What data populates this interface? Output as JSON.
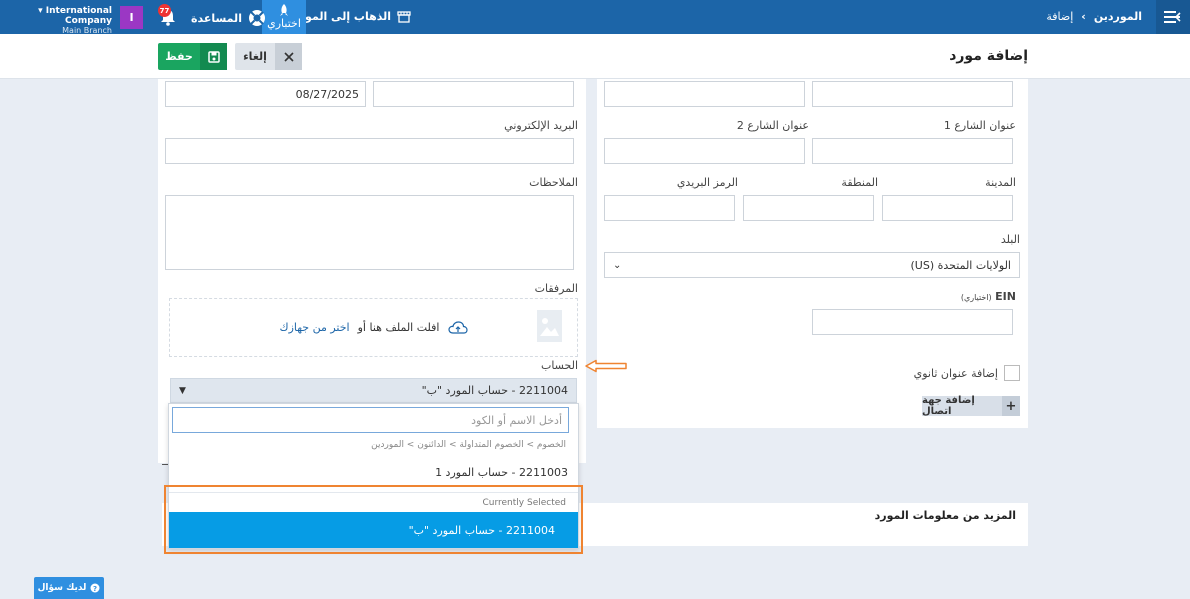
{
  "topbar": {
    "breadcrumb_parent": "الموردين",
    "breadcrumb_sep": "›",
    "breadcrumb_current": "إضافة",
    "goto_site": "الذهاب إلى الموقع",
    "trial": "اختباري",
    "help": "المساعدة",
    "notification_count": "77",
    "avatar_letter": "I",
    "company_name": "International Company",
    "branch_name": "Main Branch"
  },
  "header": {
    "page_title": "إضافة مورد",
    "save_label": "حفظ",
    "cancel_label": "إلغاء"
  },
  "form": {
    "date_value": "08/27/2025",
    "email_label": "البريد الإلكتروني",
    "notes_label": "الملاحظات",
    "attachments_label": "المرفقات",
    "drop_text": "افلت الملف هنا أو",
    "drop_link": "اختر من جهازك",
    "account_label": "الحساب",
    "account_selected": "2211004 - حساب المورد \"ب\"",
    "street1_label": "عنوان الشارع 1",
    "street2_label": "عنوان الشارع 2",
    "city_label": "المدينة",
    "region_label": "المنطقة",
    "postal_label": "الرمز البريدي",
    "country_label": "البلد",
    "country_value": "الولايات المتحدة (US)",
    "ein_label": "EIN",
    "ein_optional": "(اختياري)",
    "secondary_address_label": "إضافة عنوان ثانوي",
    "add_contact_label": "إضافة جهة اتصال"
  },
  "dropdown": {
    "search_placeholder": "أدخل الاسم أو الكود",
    "path": "الخصوم > الخصوم المتداولة > الدائنون > الموردين",
    "option_1": "2211003 - حساب المورد 1",
    "currently_selected_label": "Currently Selected",
    "selected_option": "2211004 - حساب المورد \"ب\""
  },
  "more_info": {
    "title": "المزيد من معلومات المورد"
  },
  "ask_button": "لديك سؤال",
  "colors": {
    "topbar": "#1c65a8",
    "save": "#1aa560",
    "selected": "#069ce5",
    "highlight": "#ef8431"
  }
}
